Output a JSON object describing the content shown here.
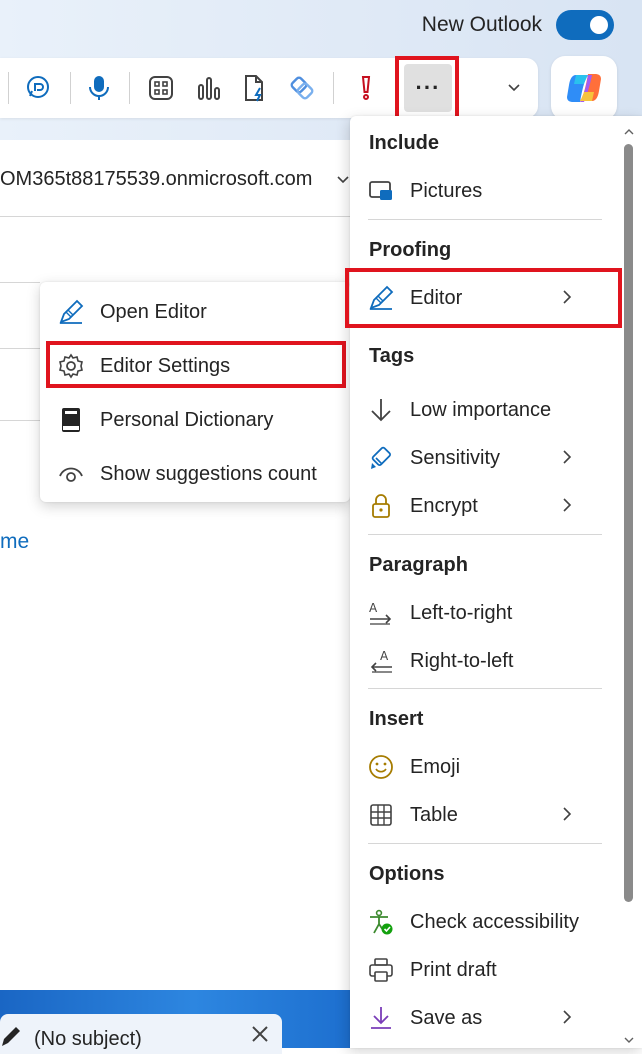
{
  "header": {
    "new_outlook_label": "New Outlook",
    "new_outlook_enabled": true
  },
  "toolbar": {
    "icons": [
      "loop-icon",
      "dictate-icon",
      "apps-icon",
      "poll-icon",
      "file-icon",
      "viva-icon",
      "importance-icon",
      "more-options-icon",
      "expand-chevron-icon",
      "copilot-icon"
    ],
    "more_label": "···"
  },
  "compose": {
    "from_address": "OM365t88175539.onmicrosoft.com",
    "link_text": "me"
  },
  "taskbar": {
    "draft_title": "(No subject)"
  },
  "submenu": {
    "items": [
      {
        "label": "Open Editor",
        "icon": "editor-pen-icon"
      },
      {
        "label": "Editor Settings",
        "icon": "gear-icon"
      },
      {
        "label": "Personal Dictionary",
        "icon": "dictionary-icon"
      },
      {
        "label": "Show suggestions count",
        "icon": "eye-icon"
      }
    ]
  },
  "menu": {
    "sections": [
      {
        "header": "Include",
        "items": [
          {
            "label": "Pictures",
            "icon": "pictures-icon",
            "submenu": false
          }
        ]
      },
      {
        "header": "Proofing",
        "items": [
          {
            "label": "Editor",
            "icon": "editor-pen-icon",
            "submenu": true
          }
        ]
      },
      {
        "header": "Tags",
        "items": [
          {
            "label": "Low importance",
            "icon": "arrow-down-icon",
            "submenu": false
          },
          {
            "label": "Sensitivity",
            "icon": "sensitivity-icon",
            "submenu": true
          },
          {
            "label": "Encrypt",
            "icon": "lock-icon",
            "submenu": true
          }
        ]
      },
      {
        "header": "Paragraph",
        "items": [
          {
            "label": "Left-to-right",
            "icon": "ltr-icon",
            "submenu": false
          },
          {
            "label": "Right-to-left",
            "icon": "rtl-icon",
            "submenu": false
          }
        ]
      },
      {
        "header": "Insert",
        "items": [
          {
            "label": "Emoji",
            "icon": "emoji-icon",
            "submenu": false
          },
          {
            "label": "Table",
            "icon": "table-icon",
            "submenu": true
          }
        ]
      },
      {
        "header": "Options",
        "items": [
          {
            "label": "Check accessibility",
            "icon": "accessibility-icon",
            "submenu": false
          },
          {
            "label": "Print draft",
            "icon": "printer-icon",
            "submenu": false
          },
          {
            "label": "Save as",
            "icon": "save-as-icon",
            "submenu": true
          }
        ]
      }
    ]
  },
  "colors": {
    "accent": "#0f6cbd",
    "highlight_box": "#e0141e",
    "importance_red": "#c50f1f"
  }
}
